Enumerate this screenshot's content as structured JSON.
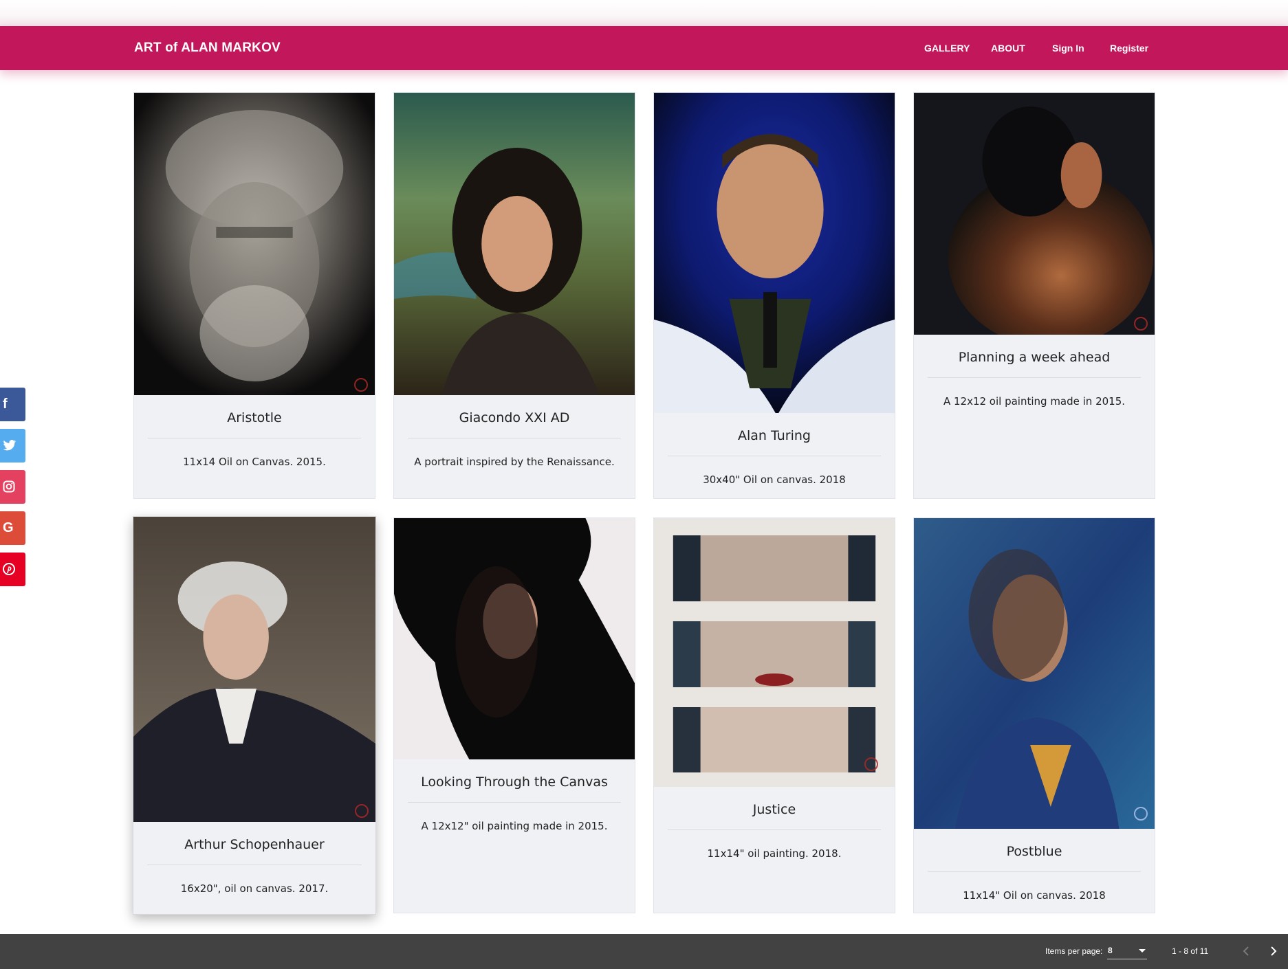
{
  "app": {
    "brand": "ART of ALAN MARKOV"
  },
  "nav": {
    "gallery": "GALLERY",
    "about": "ABOUT",
    "sign_in": "Sign In",
    "register": "Register"
  },
  "social": [
    "facebook-icon",
    "twitter-icon",
    "instagram-icon",
    "google-icon",
    "pinterest-icon"
  ],
  "colors": {
    "accent": "#c2185b",
    "footer": "#424242",
    "card_bg": "#f0f1f5"
  },
  "paintings": [
    {
      "title": "Aristotle",
      "description": "11x14 Oil on Canvas. 2015."
    },
    {
      "title": "Giacondo XXI AD",
      "description": "A portrait inspired by the Renaissance."
    },
    {
      "title": "Alan Turing",
      "description": "30x40\" Oil on canvas. 2018"
    },
    {
      "title": "Planning a week ahead",
      "description": "A 12x12 oil painting made in 2015."
    },
    {
      "title": "Arthur Schopenhauer",
      "description": "16x20\", oil on canvas. 2017."
    },
    {
      "title": "Looking Through the Canvas",
      "description": "A 12x12\" oil painting made in 2015."
    },
    {
      "title": "Justice",
      "description": "11x14\" oil painting. 2018."
    },
    {
      "title": "Postblue",
      "description": "11x14\" Oil on canvas. 2018"
    }
  ],
  "paginator": {
    "items_per_page_label": "Items per page:",
    "items_per_page": "8",
    "range_label": "1 - 8 of 11"
  }
}
